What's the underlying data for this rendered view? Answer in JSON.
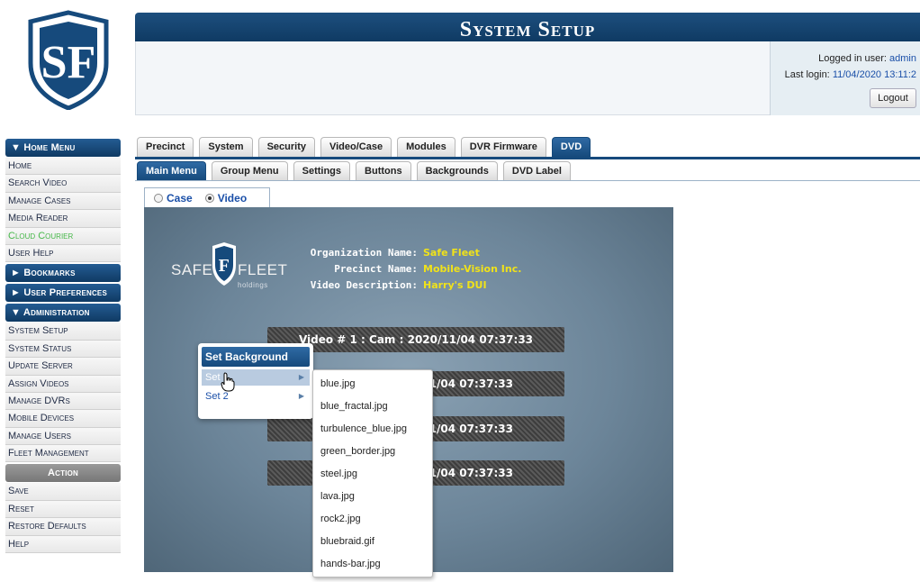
{
  "header": {
    "title": "System Setup"
  },
  "login": {
    "user_label": "Logged in user:",
    "user": "admin",
    "last_label": "Last login:",
    "last": "11/04/2020 13:11:2",
    "logout": "Logout"
  },
  "sidebar": {
    "home_menu": "▼ Home Menu",
    "home_items": [
      "Home",
      "Search Video",
      "Manage Cases",
      "Media Reader",
      "Cloud Courier",
      "User Help"
    ],
    "bookmarks": "► Bookmarks",
    "user_prefs": "► User Preferences",
    "administration": "▼ Administration",
    "admin_items": [
      "System Setup",
      "System Status",
      "Update Server",
      "Assign Videos",
      "Manage DVRs",
      "Mobile Devices",
      "Manage Users",
      "Fleet Management"
    ],
    "action": "Action",
    "action_items": [
      "Save",
      "Reset",
      "Restore Defaults",
      "Help"
    ]
  },
  "tabs": {
    "primary": [
      "Precinct",
      "System",
      "Security",
      "Video/Case",
      "Modules",
      "DVR Firmware",
      "DVD"
    ],
    "secondary": [
      "Main Menu",
      "Group Menu",
      "Settings",
      "Buttons",
      "Backgrounds",
      "DVD Label"
    ]
  },
  "radio": {
    "case": "Case",
    "video": "Video"
  },
  "preview": {
    "logo_text": "SAFE",
    "logo_text2": "FLEET",
    "logo_sub": "holdings",
    "org_label": "Organization Name:",
    "org": "Safe Fleet",
    "precinct_label": "Precinct Name:",
    "precinct": "Mobile-Vision Inc.",
    "desc_label": "Video Description:",
    "desc": "Harry's DUI",
    "video1": "Video # 1 : Cam : 2020/11/04 07:37:33",
    "video2": "/11/04 07:37:33",
    "video3": "/11/04 07:37:33",
    "video4": "/11/04 07:37:33"
  },
  "context_menu": {
    "title": "Set Background",
    "set1": "Set",
    "set2": "Set 2",
    "files": [
      "blue.jpg",
      "blue_fractal.jpg",
      "turbulence_blue.jpg",
      "green_border.jpg",
      "steel.jpg",
      "lava.jpg",
      "rock2.jpg",
      "bluebraid.gif",
      "hands-bar.jpg"
    ]
  }
}
